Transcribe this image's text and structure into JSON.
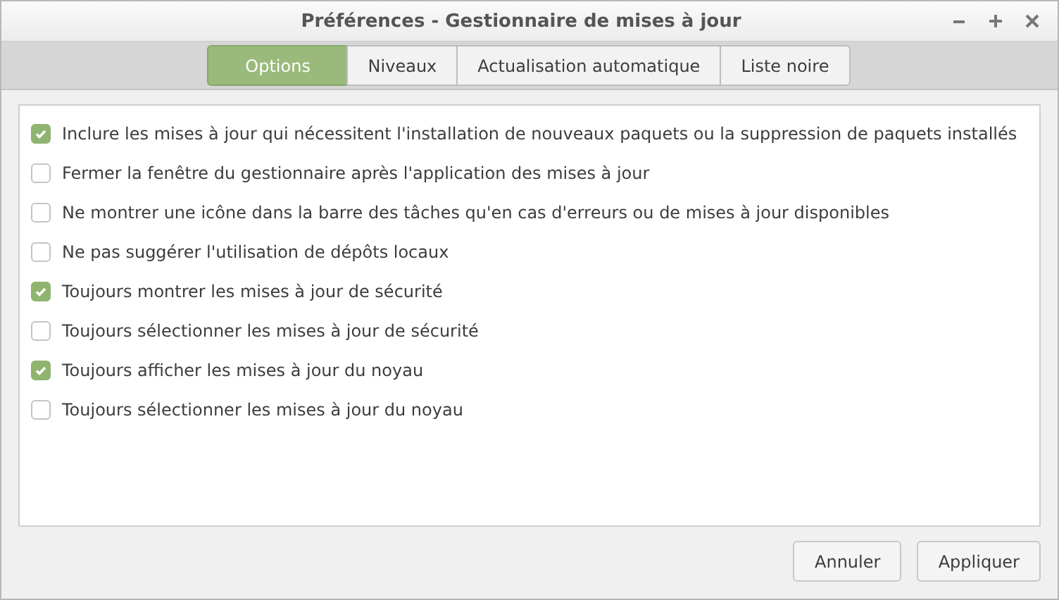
{
  "window": {
    "title": "Préférences - Gestionnaire de mises à jour"
  },
  "tabs": [
    {
      "label": "Options",
      "selected": true
    },
    {
      "label": "Niveaux",
      "selected": false
    },
    {
      "label": "Actualisation automatique",
      "selected": false
    },
    {
      "label": "Liste noire",
      "selected": false
    }
  ],
  "options": [
    {
      "label": "Inclure les mises à jour qui nécessitent l'installation de nouveaux paquets ou la suppression de paquets installés",
      "checked": true
    },
    {
      "label": "Fermer la fenêtre du gestionnaire après l'application des mises à jour",
      "checked": false
    },
    {
      "label": "Ne montrer une icône dans la barre des tâches qu'en cas d'erreurs ou de mises à jour disponibles",
      "checked": false
    },
    {
      "label": "Ne pas suggérer l'utilisation de dépôts locaux",
      "checked": false
    },
    {
      "label": "Toujours montrer les mises à jour de sécurité",
      "checked": true
    },
    {
      "label": "Toujours sélectionner les mises à jour de sécurité",
      "checked": false
    },
    {
      "label": "Toujours afficher les mises à jour du noyau",
      "checked": true
    },
    {
      "label": "Toujours sélectionner les mises à jour du noyau",
      "checked": false
    }
  ],
  "buttons": [
    "Annuler",
    "Appliquer"
  ]
}
